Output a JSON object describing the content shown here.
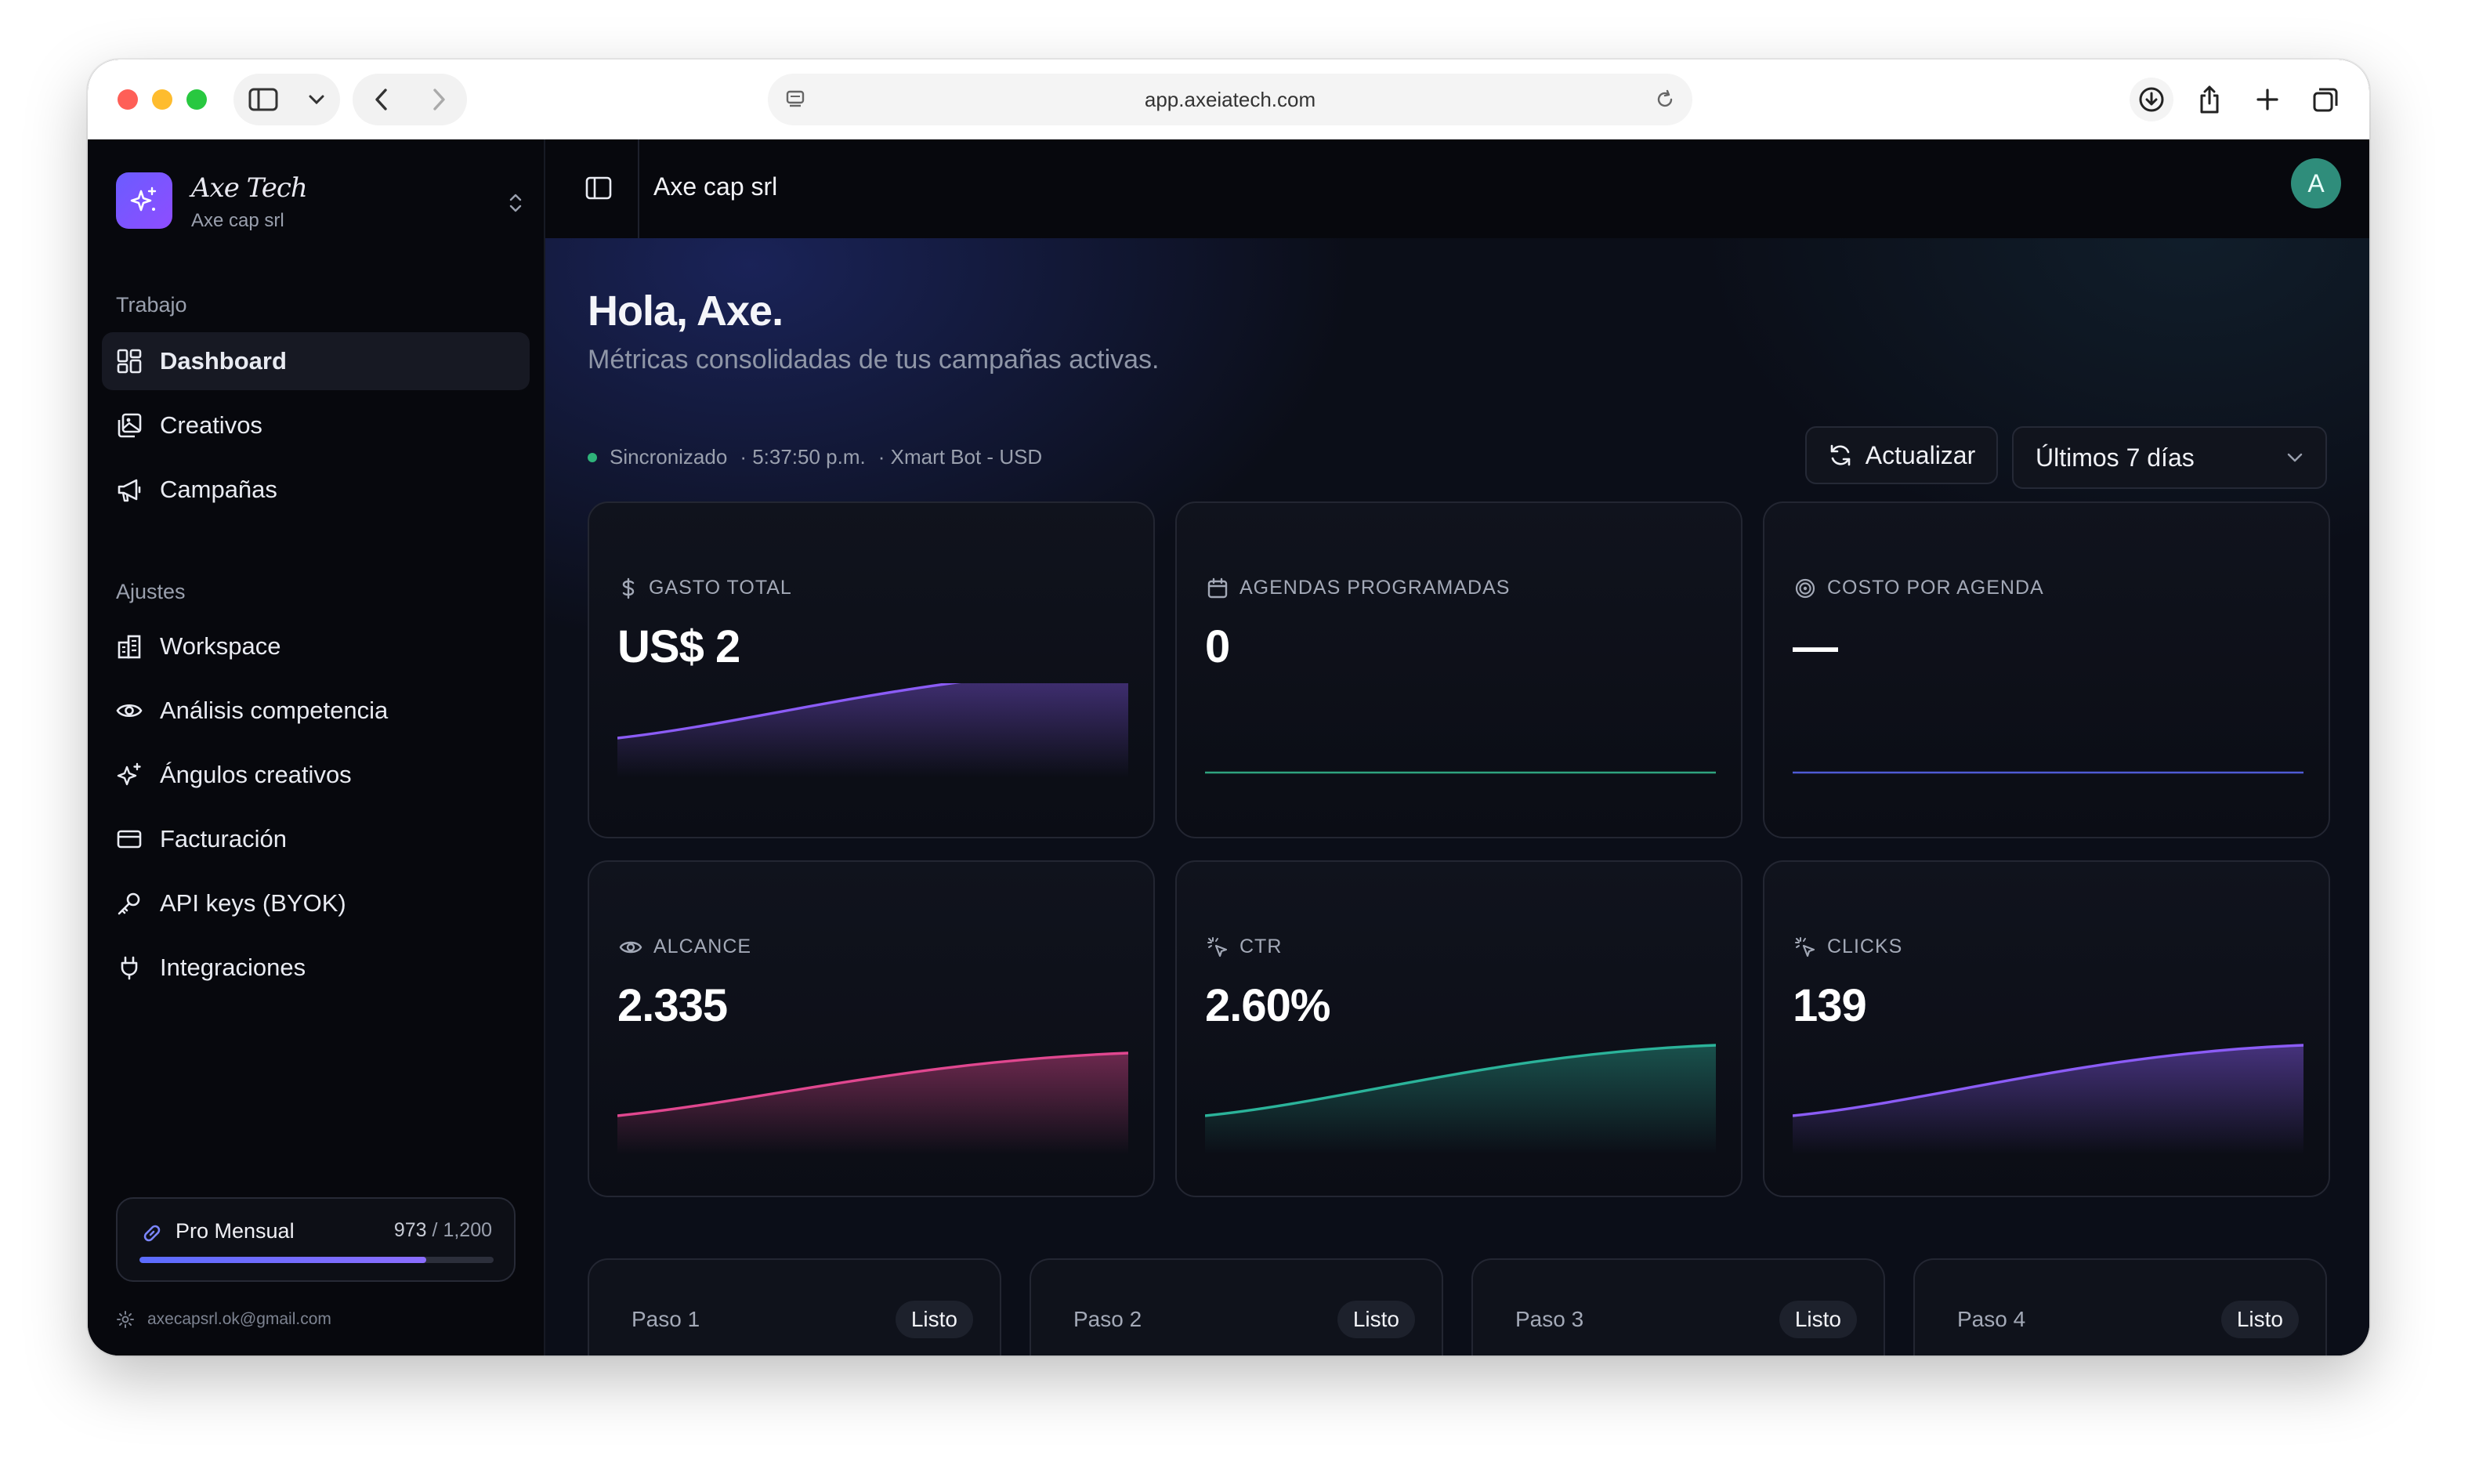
{
  "browser": {
    "url": "app.axeiatech.com"
  },
  "sidebar": {
    "brand_name": "Axe Tech",
    "brand_org": "Axe cap srl",
    "sections": [
      {
        "label": "Trabajo",
        "items": [
          {
            "label": "Dashboard",
            "icon": "dashboard-icon",
            "active": true
          },
          {
            "label": "Creativos",
            "icon": "images-icon"
          },
          {
            "label": "Campañas",
            "icon": "megaphone-icon"
          }
        ]
      },
      {
        "label": "Ajustes",
        "items": [
          {
            "label": "Workspace",
            "icon": "building-icon"
          },
          {
            "label": "Análisis competencia",
            "icon": "eye-icon"
          },
          {
            "label": "Ángulos creativos",
            "icon": "sparkles-icon"
          },
          {
            "label": "Facturación",
            "icon": "credit-card-icon"
          },
          {
            "label": "API keys (BYOK)",
            "icon": "key-icon"
          },
          {
            "label": "Integraciones",
            "icon": "plug-icon"
          }
        ]
      }
    ],
    "plan": {
      "name": "Pro Mensual",
      "used": "973",
      "limit": "1,200",
      "separator": " / ",
      "progress": 0.81
    },
    "account_email": "axecapsrl.ok@gmail.com"
  },
  "topbar": {
    "org_name": "Axe cap srl",
    "avatar_initial": "A"
  },
  "header": {
    "greeting": "Hola, Axe.",
    "subtitle": "Métricas consolidadas de tus campañas activas."
  },
  "status": {
    "sync": "Sincronizado",
    "time": "· 5:37:50 p.m.",
    "account": "· Xmart Bot - USD"
  },
  "controls": {
    "refresh_label": "Actualizar",
    "range_value": "Últimos 7 días"
  },
  "metrics": [
    {
      "label": "GASTO TOTAL",
      "value": "US$ 2",
      "icon": "dollar-icon",
      "color": "#8b5cf6"
    },
    {
      "label": "AGENDAS PROGRAMADAS",
      "value": "0",
      "icon": "calendar-icon",
      "color": "#2fa37f"
    },
    {
      "label": "COSTO POR AGENDA",
      "value": "—",
      "icon": "target-icon",
      "color": "#4f5bd5"
    },
    {
      "label": "ALCANCE",
      "value": "2.335",
      "icon": "eye-icon",
      "color": "#e0478f"
    },
    {
      "label": "CTR",
      "value": "2.60%",
      "icon": "cursor-click-icon",
      "color": "#2bb39a"
    },
    {
      "label": "CLICKS",
      "value": "139",
      "icon": "cursor-click-icon",
      "color": "#8b5cf6"
    }
  ],
  "steps": [
    {
      "label": "Paso 1",
      "badge": "Listo"
    },
    {
      "label": "Paso 2",
      "badge": "Listo"
    },
    {
      "label": "Paso 3",
      "badge": "Listo"
    },
    {
      "label": "Paso 4",
      "badge": "Listo"
    }
  ]
}
